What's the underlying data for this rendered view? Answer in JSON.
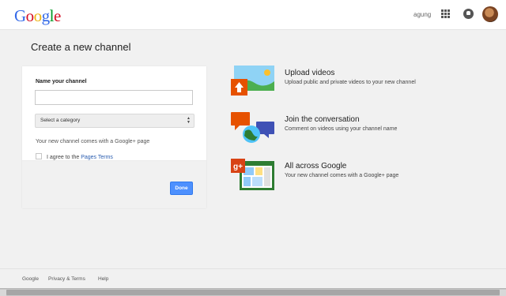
{
  "header": {
    "logo_letters": [
      "G",
      "o",
      "o",
      "g",
      "l",
      "e"
    ],
    "logo_colors": [
      "#3369e8",
      "#d50f25",
      "#eeb211",
      "#3369e8",
      "#009925",
      "#d50f25"
    ],
    "username": "agung"
  },
  "page_title": "Create a new channel",
  "form": {
    "name_label": "Name your channel",
    "name_value": "",
    "category_selected": "Select a category",
    "gplus_note": "Your new channel comes with a Google+ page",
    "terms_prefix": "I agree to the ",
    "terms_link": "Pages Terms",
    "done_label": "Done"
  },
  "features": [
    {
      "title": "Upload videos",
      "description": "Upload public and private videos to your new channel",
      "icon": "upload-icon"
    },
    {
      "title": "Join the conversation",
      "description": "Comment on videos using your channel name",
      "icon": "conversation-icon"
    },
    {
      "title": "All across Google",
      "description": "Your new channel comes with a Google+ page",
      "icon": "google-plus-icon"
    }
  ],
  "footer": {
    "google": "Google",
    "privacy": "Privacy & Terms",
    "help": "Help"
  },
  "colors": {
    "accent": "#4d90fe",
    "link": "#2a5db0"
  }
}
